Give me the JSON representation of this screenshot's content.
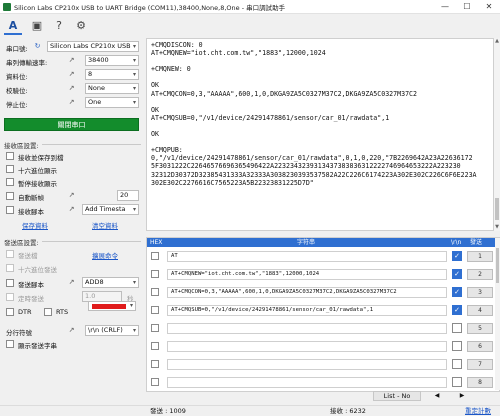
{
  "window": {
    "title": "Silicon Labs CP210x USB to UART Bridge (COM11),38400,None,8,One - 串口調試助手",
    "minimize": "—",
    "maximize": "☐",
    "close": "✕"
  },
  "toolbar": {
    "icons": [
      "font-icon",
      "image-icon",
      "help-icon",
      "settings-icon"
    ],
    "glyphs": [
      "A",
      "▣",
      "?",
      "⚙"
    ]
  },
  "serial": {
    "port_label": "串口號:",
    "port_value": "Silicon Labs CP210x USB",
    "baud_label": "串列傳輸速率:",
    "baud_value": "38400",
    "data_label": "資料位:",
    "data_value": "8",
    "parity_label": "校驗位:",
    "parity_value": "None",
    "stop_label": "停止位:",
    "stop_value": "One",
    "close_port_button": "關閉串口"
  },
  "receive_settings": {
    "title": "接收區設置:",
    "options": [
      {
        "label": "接收並保存到檔",
        "checked": false
      },
      {
        "label": "十六進位顯示",
        "checked": false
      },
      {
        "label": "暫停接收顯示",
        "checked": false
      },
      {
        "label": "自動斷幀",
        "checked": false
      },
      {
        "label": "接收腳本",
        "checked": false
      }
    ],
    "auto_break_value": "20",
    "script_select": "Add Timesta",
    "save_data_link": "保存資料",
    "clear_data_link": "清空資料"
  },
  "send_settings": {
    "title": "發送區設置:",
    "options": [
      {
        "label": "發送檔",
        "checked": false,
        "disabled": true
      },
      {
        "label": "十六進位發送",
        "checked": false,
        "disabled": true
      },
      {
        "label": "發送腳本",
        "checked": false,
        "disabled": false
      },
      {
        "label": "定時發送",
        "checked": false,
        "disabled": true
      }
    ],
    "extend_commands_link": "擴展命令",
    "script_select": "ADD8",
    "timer_value": "1.0",
    "timer_unit": "秒",
    "dtr_label": "DTR",
    "rts_label": "RTS",
    "line_sep_label": "分行符號",
    "line_sep_value": "\\r\\n (CRLF)",
    "show_send_string_label": "顯示發送字串",
    "send_color": "#e01b1b"
  },
  "receive_text": "+CMQDISCON: 0\nAT+CMQNEW=\"iot.cht.com.tw\",\"1883\",12000,1024\n\n+CMQNEW: 0\n\nOK\nAT+CMQCON=0,3,\"AAAAA\",600,1,0,DKGA9ZA5C0327M37C2,DKGA9ZA5C0327M37C2\n\nOK\nAT+CMQSUB=0,\"/v1/device/24291478861/sensor/car_01/rawdata\",1\n\nOK\n\n+CMQPUB:\n0,\"/v1/device/24291478861/sensor/car_01/rawdata\",0,1,0,220,\"7B2269642A23A22636172\n5F3031222C22646576696365496422A2232343239313437383836312222746964653222A223230\n32312D30372D32385431333A32333A3038230393537582A22C226C6174223A302E302C226C6F6E223A\n302E302C2276616C7565223A5B22323831225D7D\"",
  "send_list": {
    "headers": {
      "hex": "HEX",
      "string": "字符串",
      "crlf": "\\r\\n",
      "send": "發送"
    },
    "rows": [
      {
        "hex": false,
        "cmd": "AT",
        "crlf": true,
        "send": "1"
      },
      {
        "hex": false,
        "cmd": "AT+CMQNEW=\"iot.cht.com.tw\",\"1883\",12000,1024",
        "crlf": true,
        "send": "2"
      },
      {
        "hex": false,
        "cmd": "AT+CMQCON=0,3,\"AAAAA\",600,1,0,DKGA9ZA5C0327M37C2,DKGA9ZA5C0327M37C2",
        "crlf": true,
        "send": "3"
      },
      {
        "hex": false,
        "cmd": "AT+CMQSUB=0,\"/v1/device/24291478861/sensor/car_01/rawdata\",1",
        "crlf": true,
        "send": "4"
      },
      {
        "hex": false,
        "cmd": "",
        "crlf": false,
        "send": "5"
      },
      {
        "hex": false,
        "cmd": "",
        "crlf": false,
        "send": "6"
      },
      {
        "hex": false,
        "cmd": "",
        "crlf": false,
        "send": "7"
      },
      {
        "hex": false,
        "cmd": "",
        "crlf": false,
        "send": "8"
      }
    ],
    "list_label": "List - No",
    "prev": "◀",
    "next": "▶"
  },
  "status": {
    "sent_label": "發送 : 1009",
    "recv_label": "接收 : 6232",
    "reset_link": "重定計數"
  }
}
